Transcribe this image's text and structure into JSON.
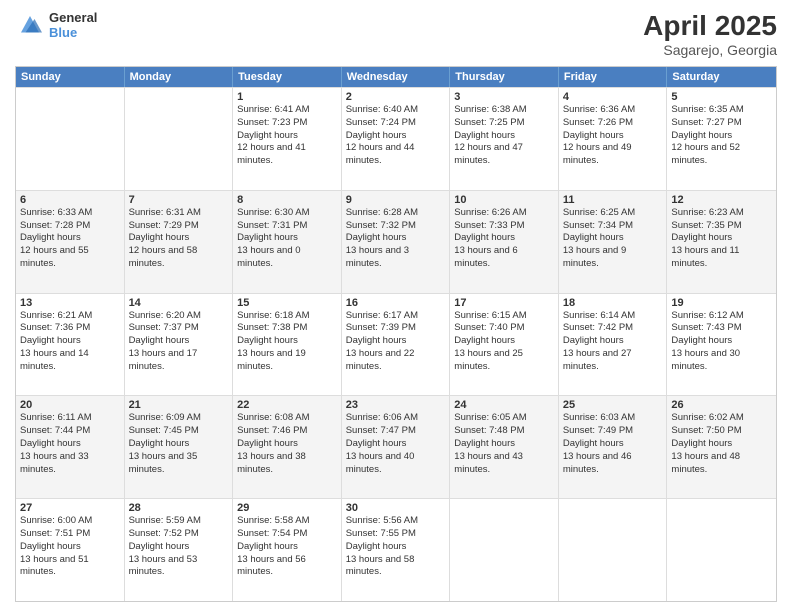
{
  "header": {
    "logo_line1": "General",
    "logo_line2": "Blue",
    "title": "April 2025",
    "subtitle": "Sagarejo, Georgia"
  },
  "days_of_week": [
    "Sunday",
    "Monday",
    "Tuesday",
    "Wednesday",
    "Thursday",
    "Friday",
    "Saturday"
  ],
  "weeks": [
    [
      {
        "day": "",
        "empty": true
      },
      {
        "day": "",
        "empty": true
      },
      {
        "day": "1",
        "sunrise": "6:41 AM",
        "sunset": "7:23 PM",
        "daylight": "12 hours and 41 minutes."
      },
      {
        "day": "2",
        "sunrise": "6:40 AM",
        "sunset": "7:24 PM",
        "daylight": "12 hours and 44 minutes."
      },
      {
        "day": "3",
        "sunrise": "6:38 AM",
        "sunset": "7:25 PM",
        "daylight": "12 hours and 47 minutes."
      },
      {
        "day": "4",
        "sunrise": "6:36 AM",
        "sunset": "7:26 PM",
        "daylight": "12 hours and 49 minutes."
      },
      {
        "day": "5",
        "sunrise": "6:35 AM",
        "sunset": "7:27 PM",
        "daylight": "12 hours and 52 minutes."
      }
    ],
    [
      {
        "day": "6",
        "sunrise": "6:33 AM",
        "sunset": "7:28 PM",
        "daylight": "12 hours and 55 minutes."
      },
      {
        "day": "7",
        "sunrise": "6:31 AM",
        "sunset": "7:29 PM",
        "daylight": "12 hours and 58 minutes."
      },
      {
        "day": "8",
        "sunrise": "6:30 AM",
        "sunset": "7:31 PM",
        "daylight": "13 hours and 0 minutes."
      },
      {
        "day": "9",
        "sunrise": "6:28 AM",
        "sunset": "7:32 PM",
        "daylight": "13 hours and 3 minutes."
      },
      {
        "day": "10",
        "sunrise": "6:26 AM",
        "sunset": "7:33 PM",
        "daylight": "13 hours and 6 minutes."
      },
      {
        "day": "11",
        "sunrise": "6:25 AM",
        "sunset": "7:34 PM",
        "daylight": "13 hours and 9 minutes."
      },
      {
        "day": "12",
        "sunrise": "6:23 AM",
        "sunset": "7:35 PM",
        "daylight": "13 hours and 11 minutes."
      }
    ],
    [
      {
        "day": "13",
        "sunrise": "6:21 AM",
        "sunset": "7:36 PM",
        "daylight": "13 hours and 14 minutes."
      },
      {
        "day": "14",
        "sunrise": "6:20 AM",
        "sunset": "7:37 PM",
        "daylight": "13 hours and 17 minutes."
      },
      {
        "day": "15",
        "sunrise": "6:18 AM",
        "sunset": "7:38 PM",
        "daylight": "13 hours and 19 minutes."
      },
      {
        "day": "16",
        "sunrise": "6:17 AM",
        "sunset": "7:39 PM",
        "daylight": "13 hours and 22 minutes."
      },
      {
        "day": "17",
        "sunrise": "6:15 AM",
        "sunset": "7:40 PM",
        "daylight": "13 hours and 25 minutes."
      },
      {
        "day": "18",
        "sunrise": "6:14 AM",
        "sunset": "7:42 PM",
        "daylight": "13 hours and 27 minutes."
      },
      {
        "day": "19",
        "sunrise": "6:12 AM",
        "sunset": "7:43 PM",
        "daylight": "13 hours and 30 minutes."
      }
    ],
    [
      {
        "day": "20",
        "sunrise": "6:11 AM",
        "sunset": "7:44 PM",
        "daylight": "13 hours and 33 minutes."
      },
      {
        "day": "21",
        "sunrise": "6:09 AM",
        "sunset": "7:45 PM",
        "daylight": "13 hours and 35 minutes."
      },
      {
        "day": "22",
        "sunrise": "6:08 AM",
        "sunset": "7:46 PM",
        "daylight": "13 hours and 38 minutes."
      },
      {
        "day": "23",
        "sunrise": "6:06 AM",
        "sunset": "7:47 PM",
        "daylight": "13 hours and 40 minutes."
      },
      {
        "day": "24",
        "sunrise": "6:05 AM",
        "sunset": "7:48 PM",
        "daylight": "13 hours and 43 minutes."
      },
      {
        "day": "25",
        "sunrise": "6:03 AM",
        "sunset": "7:49 PM",
        "daylight": "13 hours and 46 minutes."
      },
      {
        "day": "26",
        "sunrise": "6:02 AM",
        "sunset": "7:50 PM",
        "daylight": "13 hours and 48 minutes."
      }
    ],
    [
      {
        "day": "27",
        "sunrise": "6:00 AM",
        "sunset": "7:51 PM",
        "daylight": "13 hours and 51 minutes."
      },
      {
        "day": "28",
        "sunrise": "5:59 AM",
        "sunset": "7:52 PM",
        "daylight": "13 hours and 53 minutes."
      },
      {
        "day": "29",
        "sunrise": "5:58 AM",
        "sunset": "7:54 PM",
        "daylight": "13 hours and 56 minutes."
      },
      {
        "day": "30",
        "sunrise": "5:56 AM",
        "sunset": "7:55 PM",
        "daylight": "13 hours and 58 minutes."
      },
      {
        "day": "",
        "empty": true
      },
      {
        "day": "",
        "empty": true
      },
      {
        "day": "",
        "empty": true
      }
    ]
  ]
}
